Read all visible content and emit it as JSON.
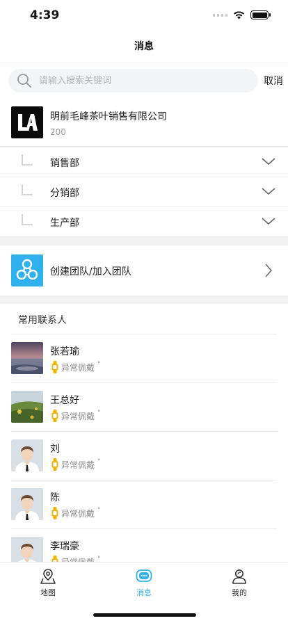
{
  "status_bar": {
    "time": "4:39"
  },
  "nav": {
    "title": "消息"
  },
  "search": {
    "placeholder": "请输入搜索关键词",
    "cancel_label": "取消"
  },
  "organization": {
    "name": "明前毛峰茶叶销售有限公司",
    "count": "200",
    "departments": [
      {
        "label": "销售部"
      },
      {
        "label": "分销部"
      },
      {
        "label": "生产部"
      }
    ]
  },
  "team_action": {
    "label": "创建团队/加入团队"
  },
  "contacts": {
    "header": "常用联系人",
    "items": [
      {
        "name": "张若瑜",
        "status": "异常佩戴",
        "dot": "°",
        "avatar": "sunset-photo"
      },
      {
        "name": "王总好",
        "status": "异常佩戴",
        "dot": "°",
        "avatar": "flower-photo"
      },
      {
        "name": "刘",
        "status": "异常佩戴",
        "dot": "°",
        "avatar": "default-person"
      },
      {
        "name": "陈",
        "status": "异常佩戴",
        "dot": "°",
        "avatar": "default-person"
      },
      {
        "name": "李瑞豪",
        "status": "异常佩戴",
        "dot": "°",
        "avatar": "default-person"
      }
    ]
  },
  "tabs": [
    {
      "label": "地图",
      "icon": "map-pin-icon",
      "active": false
    },
    {
      "label": "消息",
      "icon": "chat-icon",
      "active": true
    },
    {
      "label": "我的",
      "icon": "profile-icon",
      "active": false
    }
  ],
  "colors": {
    "accent": "#2fb1f0",
    "watch_icon": "#f0b400",
    "divider": "#ececec"
  }
}
